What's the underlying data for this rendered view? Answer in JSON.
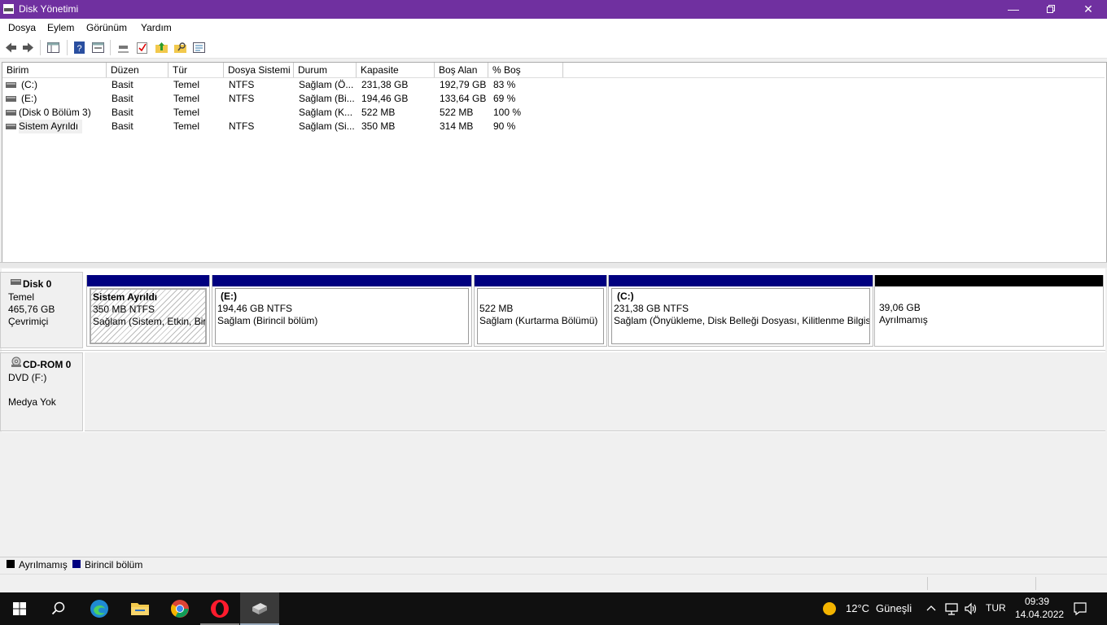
{
  "window": {
    "title": "Disk Yönetimi"
  },
  "menu": [
    "Dosya",
    "Eylem",
    "Görünüm",
    "Yardım"
  ],
  "toolbar": {
    "icons": [
      "back-arrow-icon",
      "forward-arrow-icon",
      "console-tree-icon",
      "help-icon",
      "properties-icon",
      "connect-icon",
      "check-icon",
      "up-folder-icon",
      "find-folder-icon",
      "settings-list-icon"
    ]
  },
  "volumes": {
    "columns": [
      "Birim",
      "Düzen",
      "Tür",
      "Dosya Sistemi",
      "Durum",
      "Kapasite",
      "Boş Alan",
      "% Boş"
    ],
    "rows": [
      [
        "(C:)",
        "Basit",
        "Temel",
        "NTFS",
        "Sağlam (Ö...",
        "231,38 GB",
        "192,79 GB",
        "83 %"
      ],
      [
        "(E:)",
        "Basit",
        "Temel",
        "NTFS",
        "Sağlam (Bi...",
        "194,46 GB",
        "133,64 GB",
        "69 %"
      ],
      [
        "(Disk 0 Bölüm 3)",
        "Basit",
        "Temel",
        "",
        "Sağlam (K...",
        "522 MB",
        "522 MB",
        "100 %"
      ],
      [
        "Sistem Ayrıldı",
        "Basit",
        "Temel",
        "NTFS",
        "Sağlam (Si...",
        "350 MB",
        "314 MB",
        "90 %"
      ]
    ]
  },
  "disks": {
    "disk0": {
      "name": "Disk 0",
      "type": "Temel",
      "size": "465,76 GB",
      "status": "Çevrimiçi"
    },
    "cdrom0": {
      "name": "CD-ROM 0",
      "type": "DVD (F:)",
      "status": "Medya Yok"
    }
  },
  "partitions": [
    {
      "title": "Sistem Ayrıldı",
      "size": "350 MB NTFS",
      "status": "Sağlam (Sistem, Etkin, Birincil bölüm)"
    },
    {
      "title": "(E:)",
      "size": "194,46 GB NTFS",
      "status": "Sağlam (Birincil bölüm)"
    },
    {
      "title": "",
      "size": "522 MB",
      "status": "Sağlam (Kurtarma Bölümü)"
    },
    {
      "title": "(C:)",
      "size": "231,38 GB NTFS",
      "status": "Sağlam (Önyükleme, Disk Belleği Dosyası, Kilitlenme Bilgisi, Birincil bölüm)"
    },
    {
      "title": "",
      "size": "39,06 GB",
      "status": "Ayrılmamış"
    }
  ],
  "legend": {
    "unallocated": "Ayrılmamış",
    "primary": "Birincil bölüm",
    "unallocated_color": "#000000",
    "primary_color": "#000080"
  },
  "taskbar": {
    "weather": {
      "temp": "12°C",
      "desc": "Güneşli"
    },
    "lang": "TUR",
    "time": "09:39",
    "date": "14.04.2022"
  }
}
